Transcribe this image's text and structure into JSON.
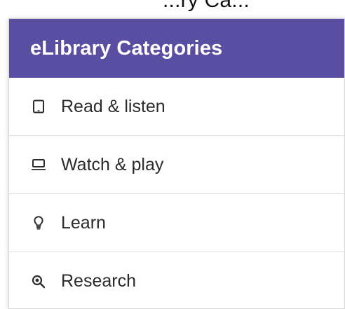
{
  "top_fragment": "...ry Ca...",
  "panel": {
    "title": "eLibrary Categories",
    "header_color": "#5a4ea3",
    "items": [
      {
        "label": "Read & listen",
        "icon": "tablet-icon"
      },
      {
        "label": "Watch & play",
        "icon": "laptop-icon"
      },
      {
        "label": "Learn",
        "icon": "lightbulb-icon"
      },
      {
        "label": "Research",
        "icon": "search-magnifier-icon"
      }
    ]
  }
}
